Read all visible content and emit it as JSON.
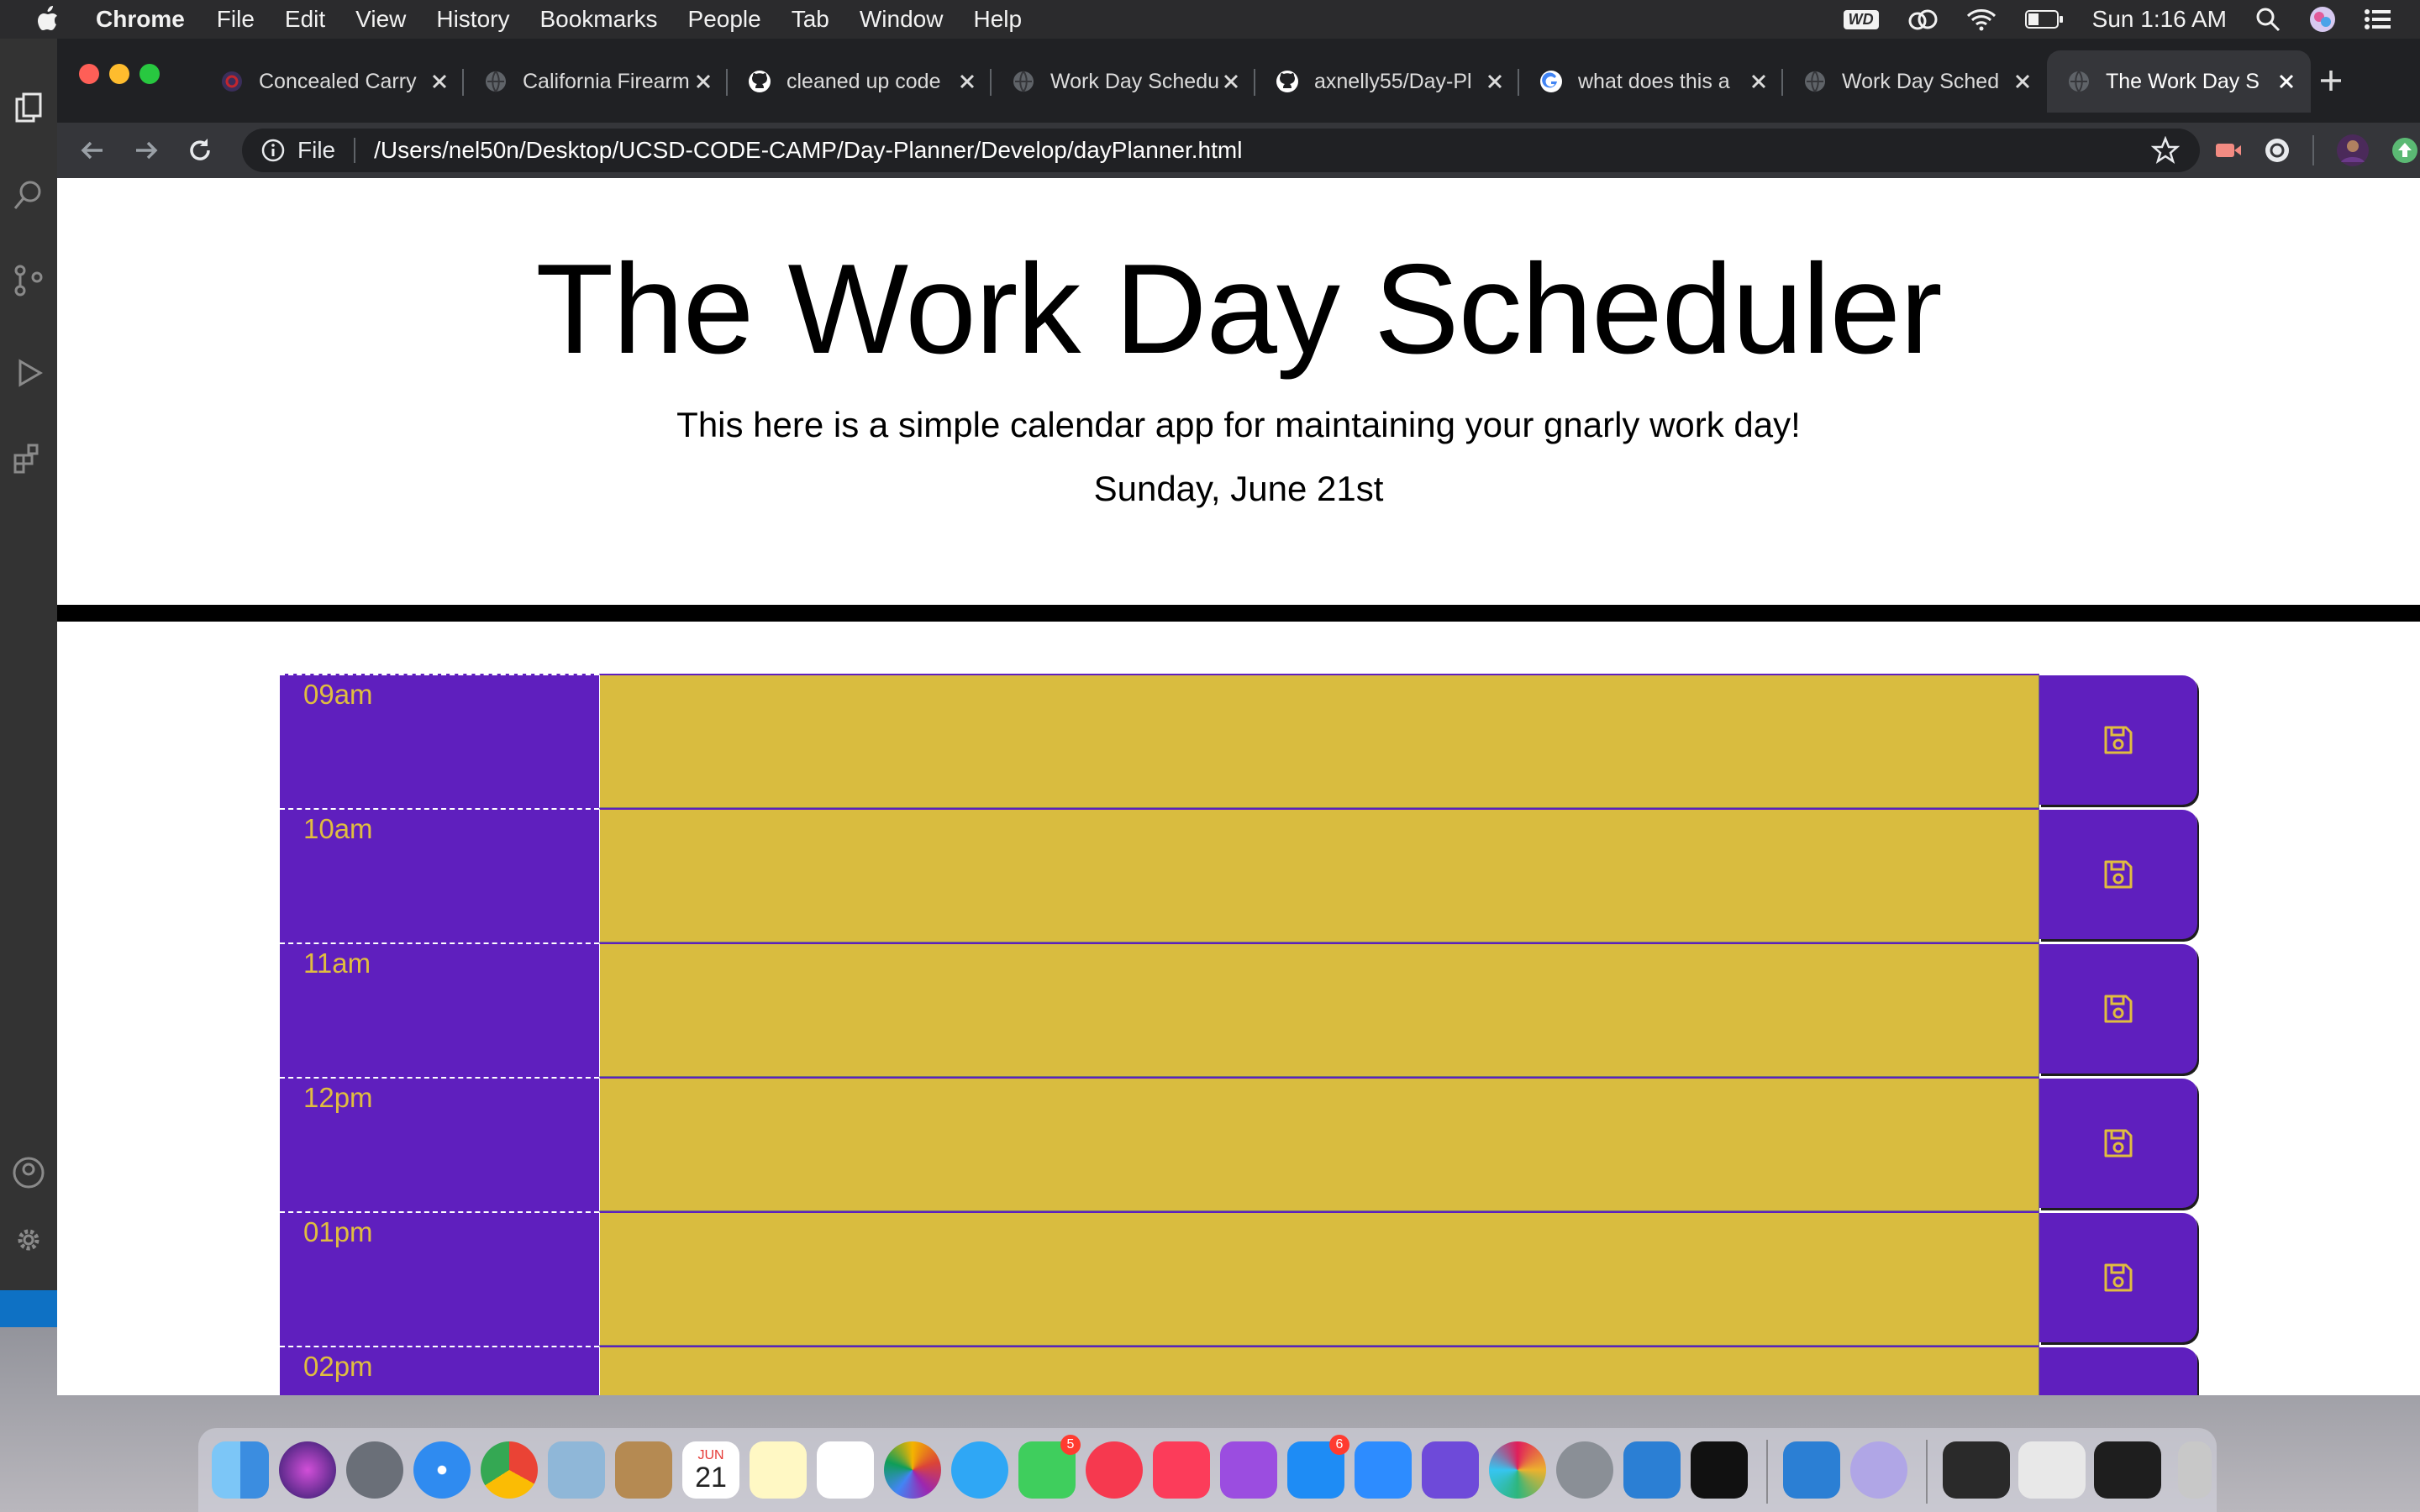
{
  "menubar": {
    "app": "Chrome",
    "items": [
      "File",
      "Edit",
      "View",
      "History",
      "Bookmarks",
      "People",
      "Tab",
      "Window",
      "Help"
    ],
    "wd_badge": "WD",
    "clock": "Sun 1:16 AM"
  },
  "tabs": [
    {
      "label": "Concealed Carry"
    },
    {
      "label": "California Firearm"
    },
    {
      "label": "cleaned up code"
    },
    {
      "label": "Work Day Schedu"
    },
    {
      "label": "axnelly55/Day-Pl"
    },
    {
      "label": "what does this a"
    },
    {
      "label": "Work Day Sched"
    },
    {
      "label": "The Work Day S"
    }
  ],
  "omnibox": {
    "scheme": "File",
    "url": "/Users/nel50n/Desktop/UCSD-CODE-CAMP/Day-Planner/Develop/dayPlanner.html"
  },
  "page": {
    "title": "The Work Day Scheduler",
    "subtitle": "This here is a simple calendar app for maintaining your gnarly work day!",
    "date": "Sunday, June 21st"
  },
  "rows": [
    {
      "hour": "09am",
      "text": ""
    },
    {
      "hour": "10am",
      "text": ""
    },
    {
      "hour": "11am",
      "text": ""
    },
    {
      "hour": "12pm",
      "text": ""
    },
    {
      "hour": "01pm",
      "text": ""
    },
    {
      "hour": "02pm",
      "text": ""
    }
  ],
  "colors": {
    "hour_bg": "#5f1fbe",
    "hour_text": "#e0bd3f",
    "textarea_bg": "#d9bc3f",
    "save_bg": "#5f1fbe"
  },
  "icons": {
    "save": "floppy-disk-icon"
  },
  "dock": {
    "calendar_month": "JUN",
    "calendar_day": "21",
    "facetime_badge": "5",
    "appstore_badge": "6"
  }
}
